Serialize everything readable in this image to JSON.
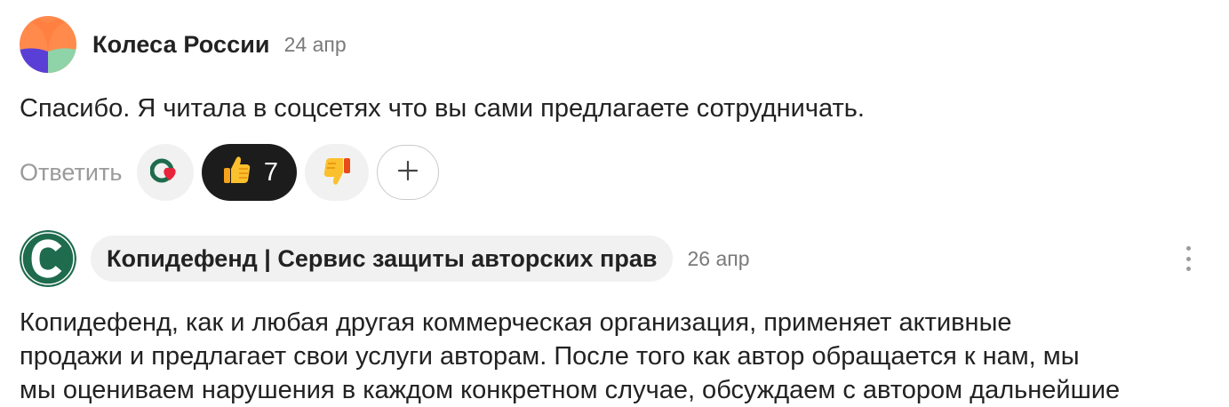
{
  "comment1": {
    "author": "Колеса России",
    "date": "24 апр",
    "text": "Спасибо. Я читала в соцсетях что вы сами предлагаете сотрудничать.",
    "reply_label": "Ответить",
    "reactions": {
      "brand_icon": "brand-heart-icon",
      "like_icon": "thumbs-up-icon",
      "like_count": "7",
      "dislike_icon": "thumbs-down-icon",
      "add_icon": "plus-icon"
    }
  },
  "comment2": {
    "author": "Копидефенд | Сервис защиты авторских прав",
    "date": "26 апр",
    "text_lines": [
      "Копидефенд, как и любая другая коммерческая организация, применяет активные",
      "продажи и предлагает свои услуги авторам. После того как автор обращается к нам, мы",
      "мы оцениваем нарушения в каждом конкретном случае, обсуждаем с автором дальнейшие"
    ],
    "more_icon": "more-vertical-icon"
  },
  "colors": {
    "like_bg": "#1c1c1c",
    "pill_bg": "#f1f1f1",
    "brand_green": "#1f6b4e",
    "avatar_orange": "#ff8a4c",
    "avatar_purple": "#5a3fd6",
    "avatar_green": "#8fd3a8"
  }
}
